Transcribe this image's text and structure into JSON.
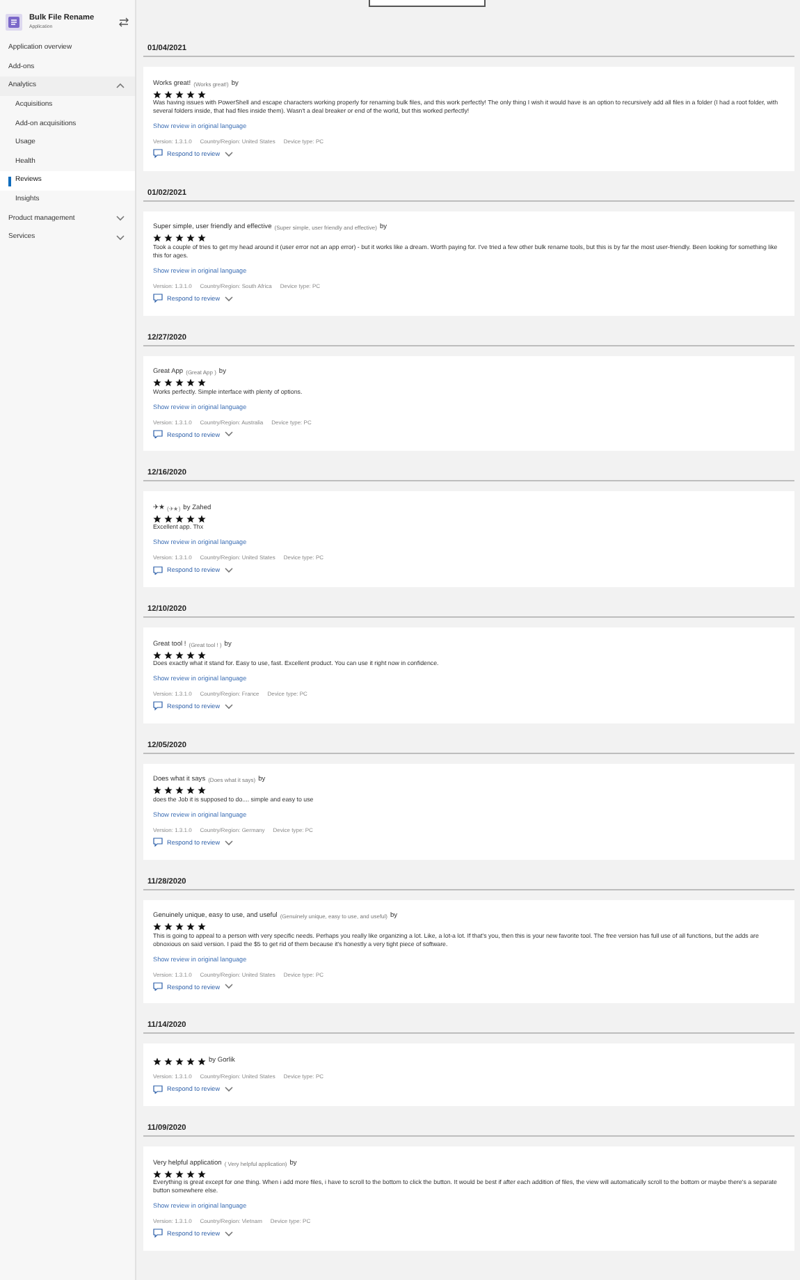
{
  "app": {
    "name": "Bulk File Rename",
    "subtitle": "Application"
  },
  "nav": [
    {
      "label": "Application overview",
      "selected": false
    },
    {
      "label": "Add-ons",
      "selected": false
    },
    {
      "label": "Analytics",
      "selected": false,
      "expanded": true,
      "children": [
        {
          "label": "Acquisitions",
          "selected": false
        },
        {
          "label": "Add-on acquisitions",
          "selected": false
        },
        {
          "label": "Usage",
          "selected": false
        },
        {
          "label": "Health",
          "selected": false
        },
        {
          "label": "Reviews",
          "selected": true
        },
        {
          "label": "Insights",
          "selected": false
        }
      ]
    },
    {
      "label": "Product management",
      "selected": false,
      "expanded": false
    },
    {
      "label": "Services",
      "selected": false,
      "expanded": false
    }
  ],
  "reviews": [
    {
      "date": "01/04/2021",
      "title": "Works great!",
      "original_title": "(Works great!)",
      "by": "by",
      "stars": 5,
      "body": "Was having issues with PowerShell and escape characters working properly for renaming bulk files, and this work perfectly!  The only thing  I wish it would have is an option to recursively add all files in a folder (I had a root folder, with several folders inside, that had files inside them). Wasn't a deal breaker or end of the world, but this worked perfectly!",
      "link": "Show review in original language",
      "version": "Version: 1.3.1.0",
      "country": "Country/Region: United States",
      "device": "Device type: PC",
      "respond": "Respond to review"
    },
    {
      "date": "01/02/2021",
      "title": "Super simple, user friendly and effective",
      "original_title": "(Super simple, user friendly and effective)",
      "by": "by",
      "stars": 5,
      "body": "Took a couple of tries to get my head around it (user error not an app error) - but it works like a dream. Worth paying for.  I've tried a few other bulk rename tools, but this is by far the most user-friendly. Been looking for something like this for ages.",
      "link": "Show review in original language",
      "version": "Version: 1.3.1.0",
      "country": "Country/Region: South Africa",
      "device": "Device type: PC",
      "respond": "Respond to review"
    },
    {
      "date": "12/27/2020",
      "title": "Great App",
      "original_title": "(Great App )",
      "by": "by",
      "stars": 5,
      "body": "Works perfectly.  Simple interface with plenty of options.",
      "link": "Show review in original language",
      "version": "Version: 1.3.1.0",
      "country": "Country/Region: Australia",
      "device": "Device type: PC",
      "respond": "Respond to review"
    },
    {
      "date": "12/16/2020",
      "title": "✈★",
      "original_title": "(✈★)",
      "by": "by Zahed",
      "stars": 5,
      "body": "Excellent app. Thx",
      "link": "Show review in original language",
      "version": "Version: 1.3.1.0",
      "country": "Country/Region: United States",
      "device": "Device type: PC",
      "respond": "Respond to review"
    },
    {
      "date": "12/10/2020",
      "title": "Great tool !",
      "original_title": "(Great tool ! )",
      "by": "by",
      "stars": 5,
      "body": "Does exactly what it stand for. Easy to use, fast. Excellent product. You can use it right now in confidence.",
      "link": "Show review in original language",
      "version": "Version: 1.3.1.0",
      "country": "Country/Region: France",
      "device": "Device type: PC",
      "respond": "Respond to review"
    },
    {
      "date": "12/05/2020",
      "title": "Does what it says",
      "original_title": "(Does what it says)",
      "by": "by",
      "stars": 5,
      "body": "does the Job it is supposed to do.... simple and easy to use",
      "link": "Show review in original language",
      "version": "Version: 1.3.1.0",
      "country": "Country/Region: Germany",
      "device": "Device type: PC",
      "respond": "Respond to review"
    },
    {
      "date": "11/28/2020",
      "title": "Genuinely unique, easy to use, and useful",
      "original_title": "(Genuinely unique, easy to use, and useful)",
      "by": "by",
      "stars": 5,
      "body": "This is going to appeal to a person with very specific needs. Perhaps you really like organizing a lot. Like, a lot-a lot. If that's you, then this is your new favorite tool. The free version has full use of all functions, but the adds are obnoxious on said version. I paid the $5 to get rid of them because it's honestly a very tight piece of software.",
      "link": "Show review in original language",
      "version": "Version: 1.3.1.0",
      "country": "Country/Region: United States",
      "device": "Device type: PC",
      "respond": "Respond to review"
    },
    {
      "date": "11/14/2020",
      "by": "by Gorlik",
      "stars": 5,
      "version": "Version: 1.3.1.0",
      "country": "Country/Region: United States",
      "device": "Device type: PC",
      "respond": "Respond to review"
    },
    {
      "date": "11/09/2020",
      "title": "Very helpful application",
      "original_title": "( Very helpful application)",
      "by": "by",
      "stars": 5,
      "body": "Everything is great except for one thing. When i add more files, i have to scroll to the bottom to click the button. It would be best if after each addition of files, the view will automatically scroll to the bottom or maybe there's a separate button somewhere else.",
      "link": "Show review in original language",
      "version": "Version: 1.3.1.0",
      "country": "Country/Region: Vietnam",
      "device": "Device type: PC",
      "respond": "Respond to review"
    }
  ]
}
